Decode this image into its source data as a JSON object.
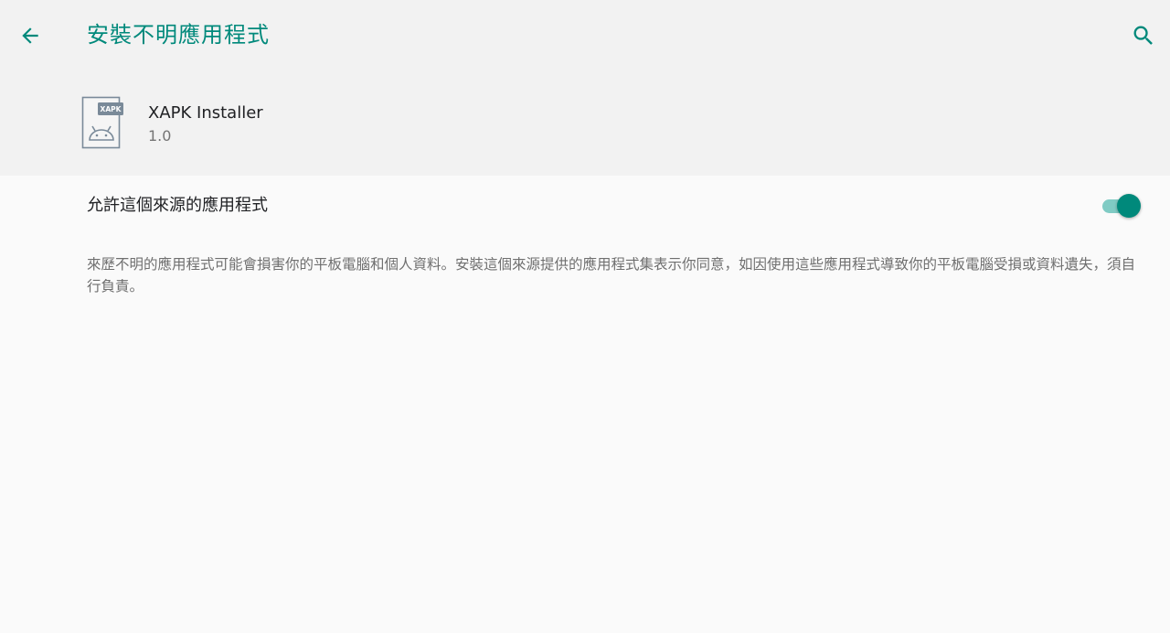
{
  "toolbar": {
    "title": "安裝不明應用程式",
    "back_icon": "arrow-back-icon",
    "search_icon": "search-icon",
    "accent_color": "#00897b"
  },
  "app": {
    "name": "XAPK Installer",
    "version": "1.0",
    "icon": "xapk-file-icon",
    "icon_badge": "XAPK"
  },
  "setting": {
    "label": "允許這個來源的應用程式",
    "enabled": true
  },
  "description": "來歷不明的應用程式可能會損害你的平板電腦和個人資料。安裝這個來源提供的應用程式集表示你同意，如因使用這些應用程式導致你的平板電腦受損或資料遺失，須自行負責。"
}
